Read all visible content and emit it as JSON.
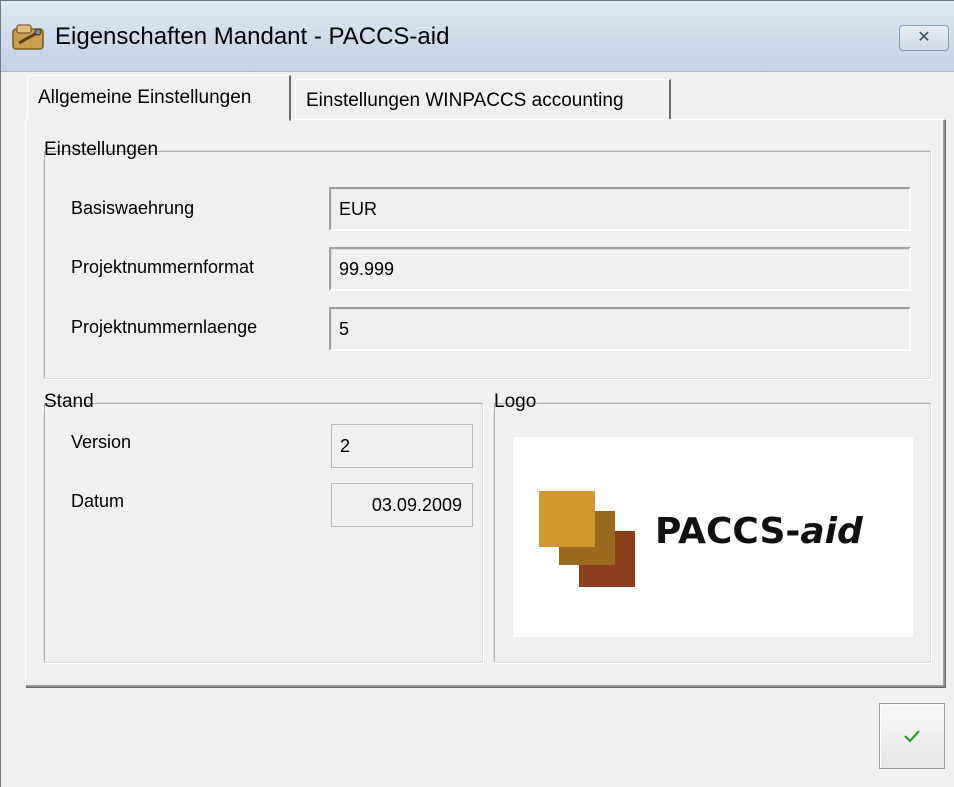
{
  "window": {
    "title": "Eigenschaften Mandant - PACCS-aid",
    "close_glyph": "✕"
  },
  "tabs": [
    {
      "label": "Allgemeine Einstellungen",
      "active": true
    },
    {
      "label": "Einstellungen WINPACCS accounting",
      "active": false
    }
  ],
  "settings": {
    "legend": "Einstellungen",
    "fields": [
      {
        "label": "Basiswaehrung",
        "value": "EUR"
      },
      {
        "label": "Projektnummernformat",
        "value": "99.999"
      },
      {
        "label": "Projektnummernlaenge",
        "value": "5"
      }
    ]
  },
  "stand": {
    "legend": "Stand",
    "version_label": "Version",
    "version_value": "2",
    "datum_label": "Datum",
    "datum_value": "03.09.2009"
  },
  "logo": {
    "legend": "Logo",
    "brand_main": "PACCS-",
    "brand_italic": "aid",
    "colors": [
      "#d4962e",
      "#9c6a1c",
      "#8a3e1c"
    ]
  },
  "buttons": {
    "ok_icon": "checkmark-icon",
    "ok_color": "#2aa02a"
  }
}
